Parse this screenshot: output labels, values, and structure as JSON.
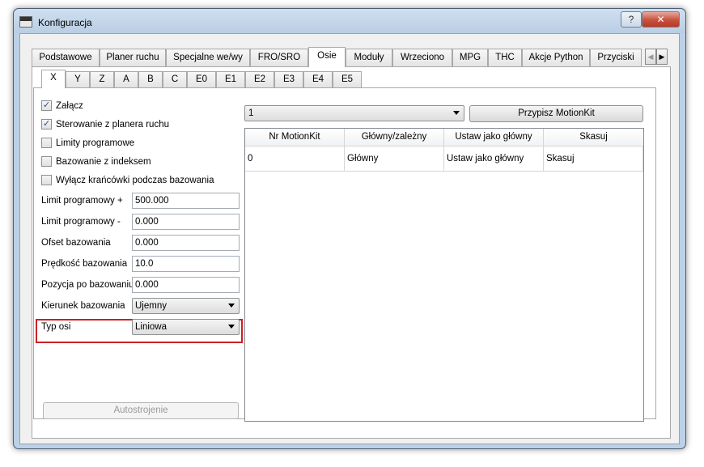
{
  "window": {
    "title": "Konfiguracja",
    "help_label": "?",
    "close_label": "✕"
  },
  "top_tabs": [
    {
      "label": "Podstawowe"
    },
    {
      "label": "Planer ruchu"
    },
    {
      "label": "Specjalne we/wy"
    },
    {
      "label": "FRO/SRO"
    },
    {
      "label": "Osie",
      "active": true
    },
    {
      "label": "Moduły"
    },
    {
      "label": "Wrzeciono"
    },
    {
      "label": "MPG"
    },
    {
      "label": "THC"
    },
    {
      "label": "Akcje Python"
    },
    {
      "label": "Przyciski"
    }
  ],
  "tab_scroll": {
    "left": "◀",
    "right": "▶"
  },
  "axis_tabs": [
    {
      "label": "X",
      "active": true
    },
    {
      "label": "Y"
    },
    {
      "label": "Z"
    },
    {
      "label": "A"
    },
    {
      "label": "B"
    },
    {
      "label": "C"
    },
    {
      "label": "E0"
    },
    {
      "label": "E1"
    },
    {
      "label": "E2"
    },
    {
      "label": "E3"
    },
    {
      "label": "E4"
    },
    {
      "label": "E5"
    }
  ],
  "checkboxes": [
    {
      "label": "Załącz",
      "checked": true
    },
    {
      "label": "Sterowanie z planera ruchu",
      "checked": true
    },
    {
      "label": "Limity programowe",
      "checked": false
    },
    {
      "label": "Bazowanie z indeksem",
      "checked": false
    },
    {
      "label": "Wyłącz krańcówki podczas bazowania",
      "checked": false
    }
  ],
  "fields": {
    "soft_limit_plus": {
      "label": "Limit programowy +",
      "value": "500.000"
    },
    "soft_limit_minus": {
      "label": "Limit programowy -",
      "value": "0.000"
    },
    "homing_offset": {
      "label": "Ofset bazowania",
      "value": "0.000"
    },
    "homing_speed": {
      "label": "Prędkość bazowania",
      "value": "10.0"
    },
    "position_after_homing": {
      "label": "Pozycja po bazowaniu",
      "value": "0.000"
    },
    "homing_direction": {
      "label": "Kierunek bazowania",
      "value": "Ujemny"
    },
    "axis_type": {
      "label": "Typ osi",
      "value": "Liniowa"
    }
  },
  "autotune_label": "Autostrojenie",
  "motionkit": {
    "selected": "1",
    "assign_label": "Przypisz MotionKit"
  },
  "table": {
    "columns": [
      "Nr MotionKit",
      "Główny/zależny",
      "Ustaw jako główny",
      "Skasuj"
    ],
    "rows": [
      [
        "0",
        "Główny",
        "Ustaw jako główny",
        "Skasuj"
      ]
    ]
  },
  "colors": {
    "highlight": "#cc1f26",
    "check_tick": "#2d4d8c",
    "window_frame": "#bcd1e8"
  }
}
